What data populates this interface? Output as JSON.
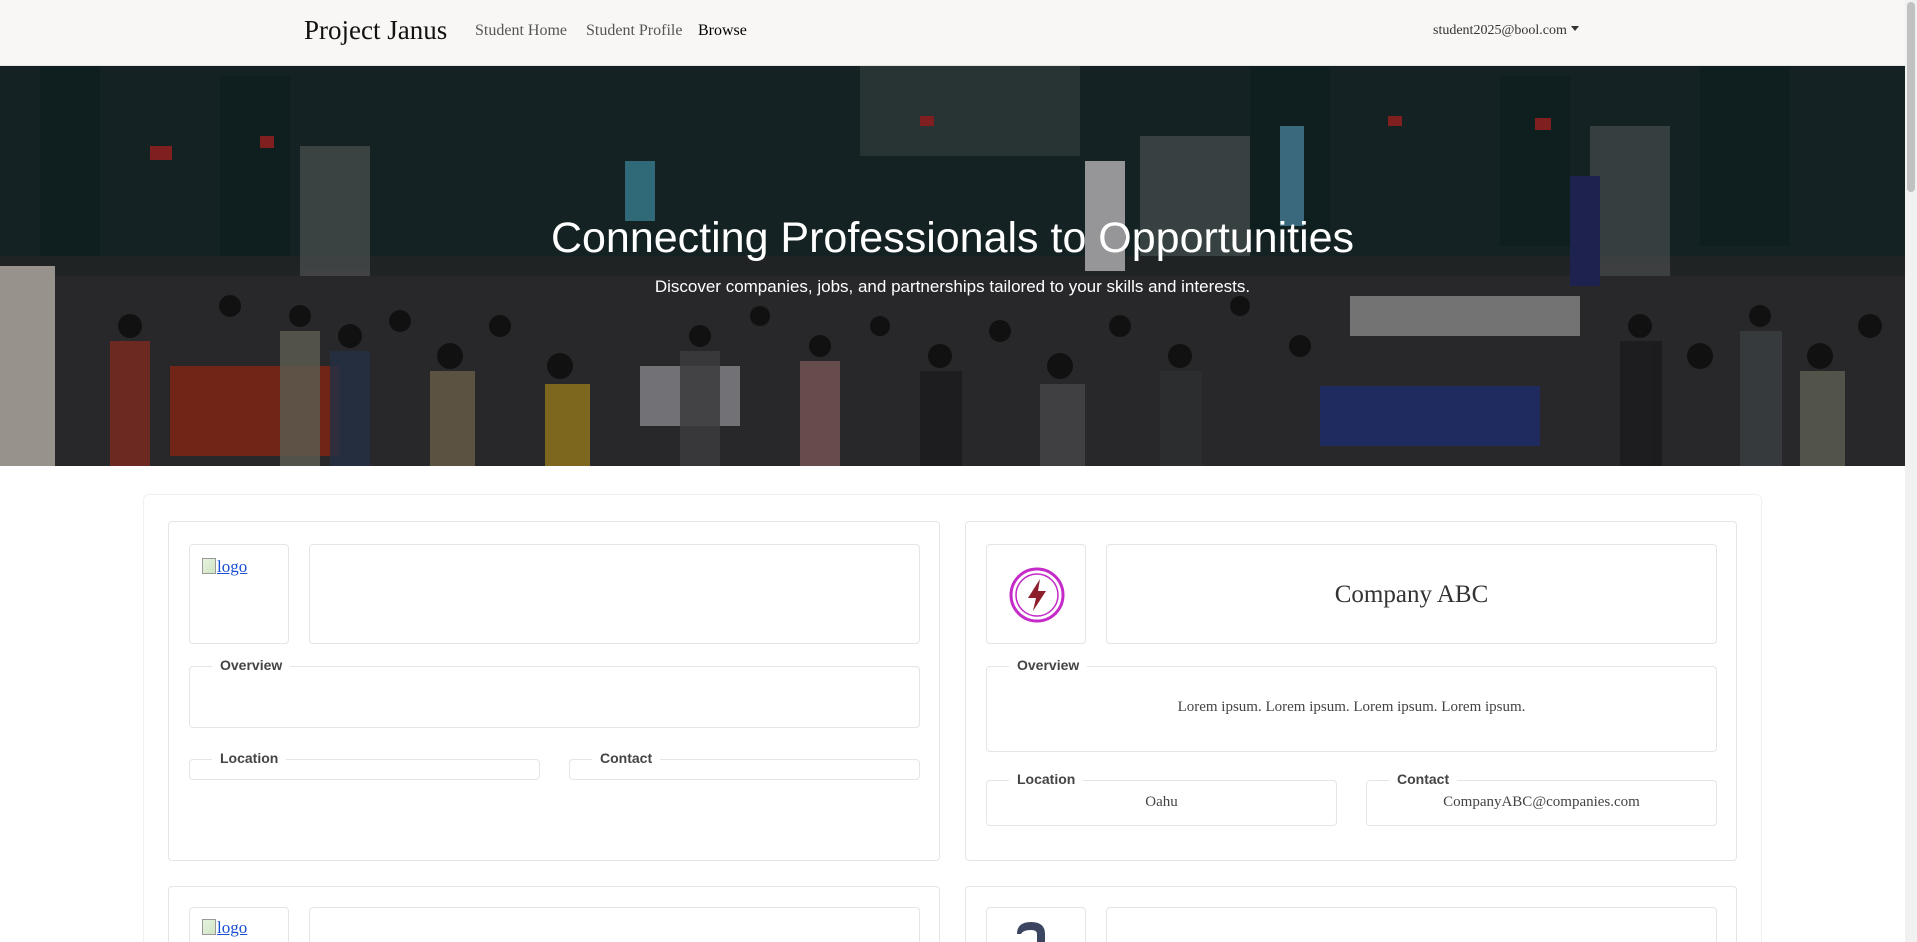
{
  "navbar": {
    "brand": "Project Janus",
    "links": [
      "Student Home",
      "Student Profile",
      "Browse"
    ],
    "active": "Browse",
    "user_email": "student2025@bool.com"
  },
  "hero": {
    "title": "Connecting Professionals to Opportunities",
    "subtitle": "Discover companies, jobs, and partnerships tailored to your skills and interests."
  },
  "companies": [
    {
      "logo_alt": "logo",
      "name": "",
      "overview_label": "Overview",
      "overview": "",
      "location_label": "Location",
      "location": "",
      "contact_label": "Contact",
      "contact": ""
    },
    {
      "logo_alt": "",
      "name": "Company ABC",
      "overview_label": "Overview",
      "overview": "Lorem ipsum. Lorem ipsum. Lorem ipsum. Lorem ipsum.",
      "location_label": "Location",
      "location": "Oahu",
      "contact_label": "Contact",
      "contact": "CompanyABC@companies.com"
    },
    {
      "logo_alt": "logo",
      "name": ""
    },
    {
      "logo_alt": "",
      "name": ""
    }
  ],
  "colors": {
    "navbar_bg": "#f8f7f5",
    "link_blue": "#1a4fd4",
    "logo_magenta": "#c42bc9",
    "logo_red": "#8c1f2a"
  }
}
